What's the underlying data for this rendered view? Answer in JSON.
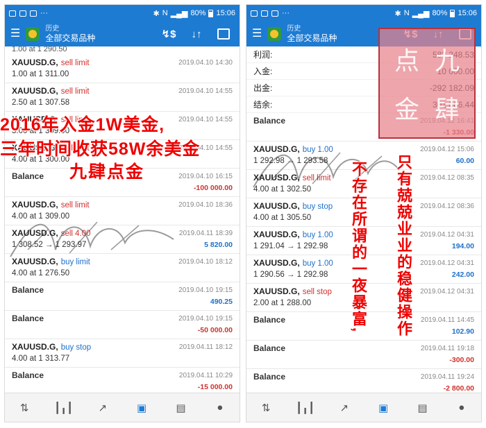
{
  "status": {
    "battery": "80%",
    "time": "15:06"
  },
  "toolbar": {
    "title": "历史",
    "subtitle": "全部交易品种"
  },
  "left": {
    "top_partial": "1.00 at 1 290.50",
    "rows": [
      {
        "sym": "XAUUSD.G,",
        "type": "sell limit",
        "kind": "sell",
        "date": "2019.04.10 14:30",
        "detail": "1.00 at 1 311.00",
        "amount": ""
      },
      {
        "sym": "XAUUSD.G,",
        "type": "sell limit",
        "kind": "sell",
        "date": "2019.04.10 14:55",
        "detail": "2.50 at 1 307.58",
        "amount": ""
      },
      {
        "sym": "XAUUSD.G,",
        "type": "sell limit",
        "kind": "sell",
        "date": "2019.04.10 14:55",
        "detail": "3.00 at 1 309.00",
        "amount": ""
      },
      {
        "sym": "XAUUSD.G,",
        "type": "sell limit",
        "kind": "sell",
        "date": "2019.04.10 14:55",
        "detail": "4.00 at 1 300.00",
        "amount": ""
      },
      {
        "sym": "Balance",
        "type": "",
        "kind": "bal",
        "date": "2019.04.10 16:15",
        "detail": "",
        "amount": "-100 000.00",
        "sign": "neg"
      },
      {
        "sym": "XAUUSD.G,",
        "type": "sell limit",
        "kind": "sell",
        "date": "2019.04.10 18:36",
        "detail": "4.00 at 1 309.00",
        "amount": ""
      },
      {
        "sym": "XAUUSD.G,",
        "type": "sell 4.00",
        "kind": "sell",
        "date": "2019.04.11 18:39",
        "detail": "1 308.52 → 1 293.97",
        "amount": "5 820.00",
        "sign": "pos"
      },
      {
        "sym": "XAUUSD.G,",
        "type": "buy limit",
        "kind": "buy",
        "date": "2019.04.10 18:12",
        "detail": "4.00 at 1 276.50",
        "amount": ""
      },
      {
        "sym": "Balance",
        "type": "",
        "kind": "bal",
        "date": "2019.04.10 19:15",
        "detail": "",
        "amount": "490.25",
        "sign": "pos"
      },
      {
        "sym": "Balance",
        "type": "",
        "kind": "bal",
        "date": "2019.04.10 19:15",
        "detail": "",
        "amount": "-50 000.00",
        "sign": "neg"
      },
      {
        "sym": "XAUUSD.G,",
        "type": "buy stop",
        "kind": "buy",
        "date": "2019.04.11 18:12",
        "detail": "4.00 at 1 313.77",
        "amount": ""
      },
      {
        "sym": "Balance",
        "type": "",
        "kind": "bal",
        "date": "2019.04.11 10:29",
        "detail": "",
        "amount": "-15 000.00",
        "sign": "neg"
      }
    ]
  },
  "right": {
    "summary": [
      {
        "label": "利润:",
        "value": "583 248.53"
      },
      {
        "label": "入金:",
        "value": "10 000.00"
      },
      {
        "label": "出金:",
        "value": "-292 182.09"
      },
      {
        "label": "结余:",
        "value": "301 066.44"
      }
    ],
    "rows": [
      {
        "sym": "Balance",
        "type": "",
        "kind": "bal",
        "date": "2019.04.12 16:41",
        "detail": "",
        "amount": "-1 330.00",
        "sign": "neg"
      },
      {
        "sym": "XAUUSD.G,",
        "type": "buy 1.00",
        "kind": "buy",
        "date": "2019.04.12 15:06",
        "detail": "1 292.98 → 1 293.58",
        "amount": "60.00",
        "sign": "pos"
      },
      {
        "sym": "XAUUSD.G,",
        "type": "sell limit",
        "kind": "sell",
        "date": "2019.04.12 08:35",
        "detail": "4.00 at 1 302.50",
        "amount": ""
      },
      {
        "sym": "XAUUSD.G,",
        "type": "buy stop",
        "kind": "buy",
        "date": "2019.04.12 08:36",
        "detail": "4.00 at 1 305.50",
        "amount": ""
      },
      {
        "sym": "XAUUSD.G,",
        "type": "buy 1.00",
        "kind": "buy",
        "date": "2019.04.12 04:31",
        "detail": "1 291.04 → 1 292.98",
        "amount": "194.00",
        "sign": "pos"
      },
      {
        "sym": "XAUUSD.G,",
        "type": "buy 1.00",
        "kind": "buy",
        "date": "2019.04.12 04:31",
        "detail": "1 290.56 → 1 292.98",
        "amount": "242.00",
        "sign": "pos"
      },
      {
        "sym": "XAUUSD.G,",
        "type": "sell stop",
        "kind": "sell",
        "date": "2019.04.12 04:31",
        "detail": "2.00 at 1 288.00",
        "amount": ""
      },
      {
        "sym": "Balance",
        "type": "",
        "kind": "bal",
        "date": "2019.04.11 14:45",
        "detail": "",
        "amount": "102.90",
        "sign": "pos"
      },
      {
        "sym": "Balance",
        "type": "",
        "kind": "bal",
        "date": "2019.04.11 19:18",
        "detail": "",
        "amount": "-300.00",
        "sign": "neg"
      },
      {
        "sym": "Balance",
        "type": "",
        "kind": "bal",
        "date": "2019.04.11 19:24",
        "detail": "",
        "amount": "-2 800.00",
        "sign": "neg"
      }
    ]
  },
  "overlay": {
    "line1": "2016年入金1W美金,",
    "line2": "三年时间收获58W余美金",
    "line3": "九肆点金",
    "vert_left": "不存在所谓的一夜暴富,",
    "vert_right": "只有兢兢业业的稳健操作"
  },
  "seal": {
    "chars": [
      "点",
      "九",
      "金",
      "肆"
    ]
  },
  "colors": {
    "accent": "#1e7bd2",
    "sell": "#d0312d",
    "buy": "#1e70c8",
    "overlay": "#ee0000"
  }
}
